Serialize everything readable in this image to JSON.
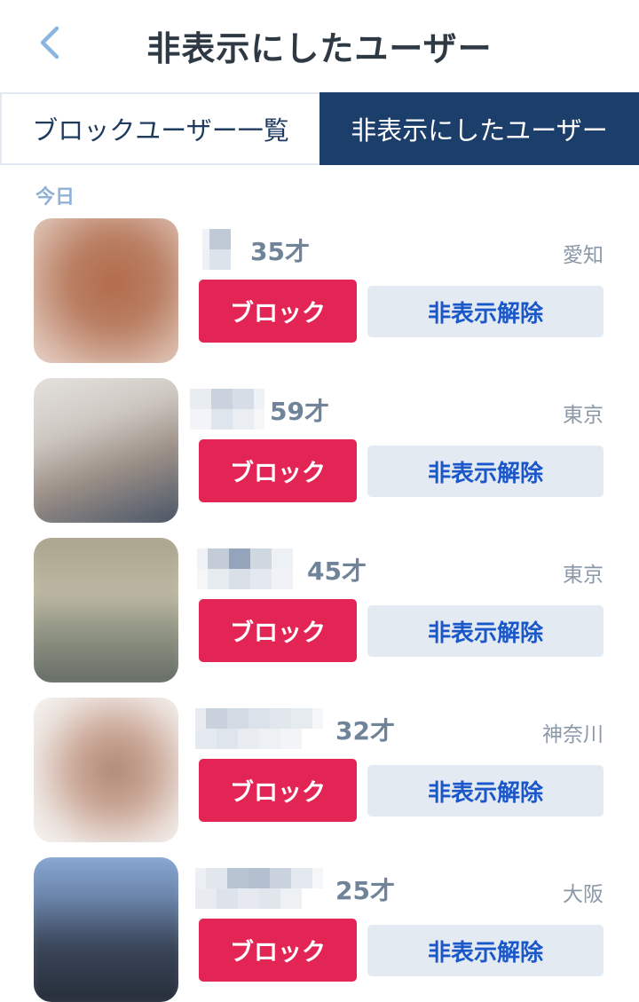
{
  "header": {
    "title": "非表示にしたユーザー",
    "back_icon": "chevron-left-icon"
  },
  "tabs": [
    {
      "label": "ブロックユーザー一覧",
      "active": false
    },
    {
      "label": "非表示にしたユーザー",
      "active": true
    }
  ],
  "section": {
    "label": "今日"
  },
  "colors": {
    "accent": "#1c3e6a",
    "block": "#e32555",
    "unhide_bg": "#e3eaf2",
    "unhide_text": "#1b57c9"
  },
  "users": [
    {
      "age": "35才",
      "location": "愛知",
      "block_label": "ブロック",
      "unhide_label": "非表示解除"
    },
    {
      "age": "59才",
      "location": "東京",
      "block_label": "ブロック",
      "unhide_label": "非表示解除"
    },
    {
      "age": "45才",
      "location": "東京",
      "block_label": "ブロック",
      "unhide_label": "非表示解除"
    },
    {
      "age": "32才",
      "location": "神奈川",
      "block_label": "ブロック",
      "unhide_label": "非表示解除"
    },
    {
      "age": "25才",
      "location": "大阪",
      "block_label": "ブロック",
      "unhide_label": "非表示解除"
    }
  ]
}
